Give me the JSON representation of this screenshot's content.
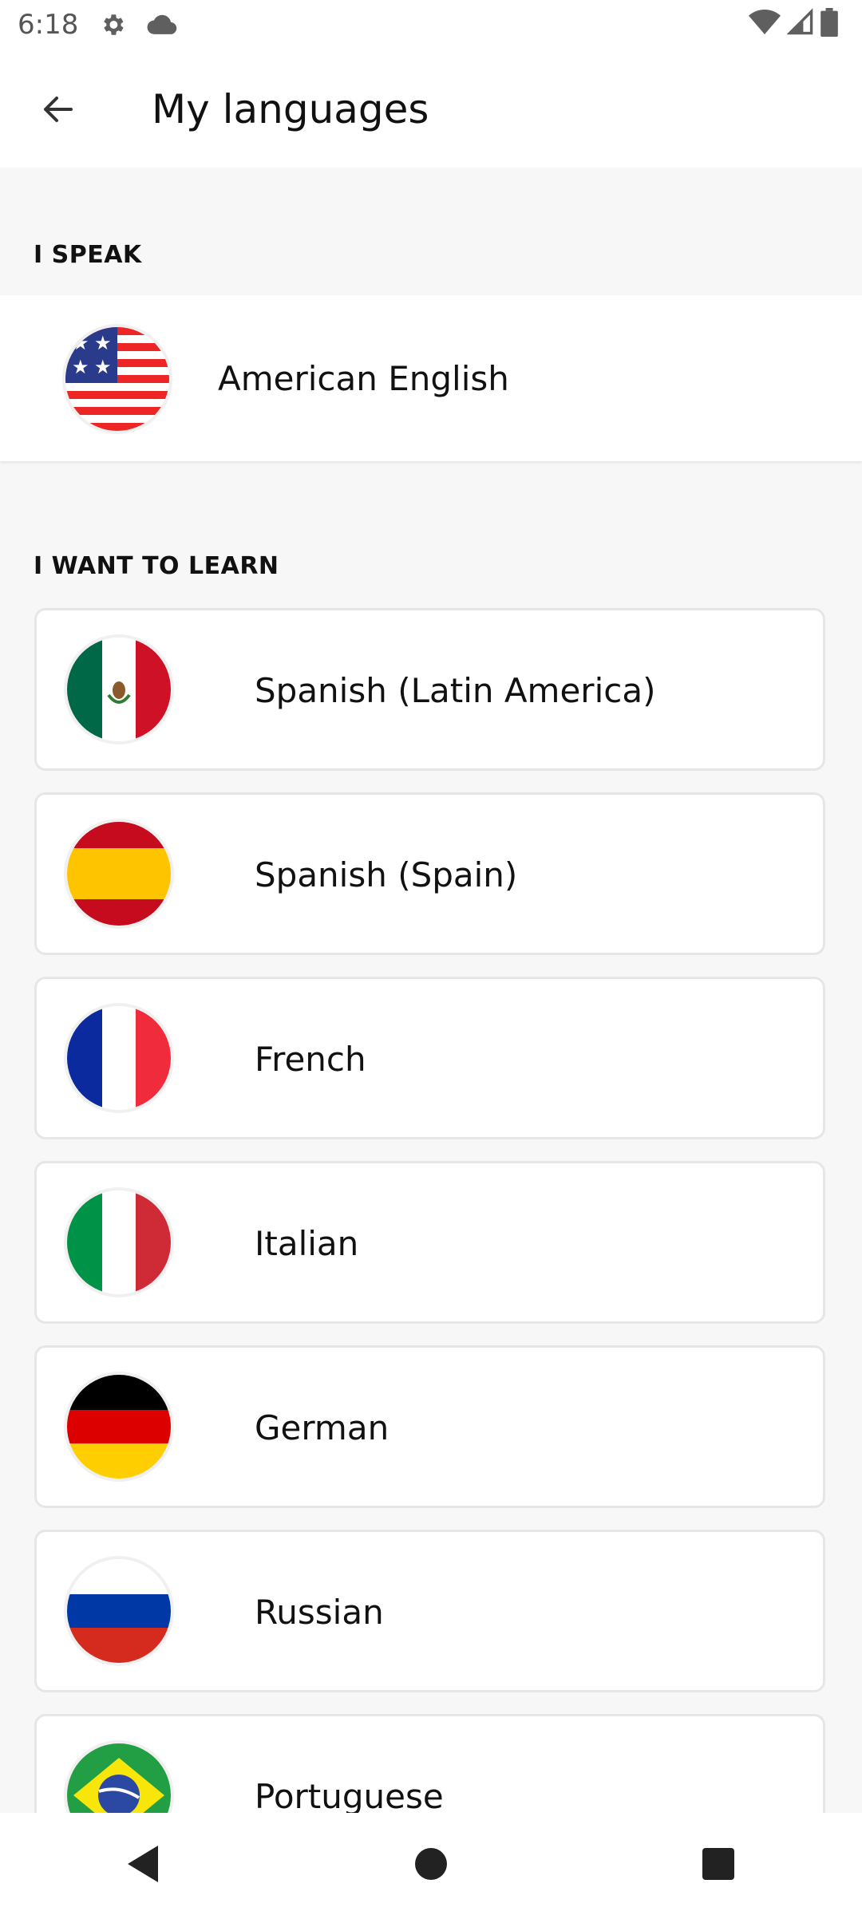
{
  "status_bar": {
    "time": "6:18",
    "icons": [
      "gear-icon",
      "cloud-icon",
      "wifi-icon",
      "signal-icon",
      "battery-icon"
    ]
  },
  "header": {
    "title": "My languages",
    "back_icon": "arrow-left-icon"
  },
  "speak_section": {
    "label": "I SPEAK",
    "language": {
      "name": "American English",
      "flag": "usa-flag-icon"
    }
  },
  "learn_section": {
    "label": "I WANT TO LEARN",
    "languages": [
      {
        "name": "Spanish (Latin America)",
        "flag": "mexico-flag-icon"
      },
      {
        "name": "Spanish (Spain)",
        "flag": "spain-flag-icon"
      },
      {
        "name": "French",
        "flag": "france-flag-icon"
      },
      {
        "name": "Italian",
        "flag": "italy-flag-icon"
      },
      {
        "name": "German",
        "flag": "germany-flag-icon"
      },
      {
        "name": "Russian",
        "flag": "russia-flag-icon"
      },
      {
        "name": "Portuguese",
        "flag": "brazil-flag-icon"
      }
    ]
  },
  "nav_bar": {
    "icons": [
      "back-triangle-icon",
      "home-circle-icon",
      "recents-square-icon"
    ]
  }
}
